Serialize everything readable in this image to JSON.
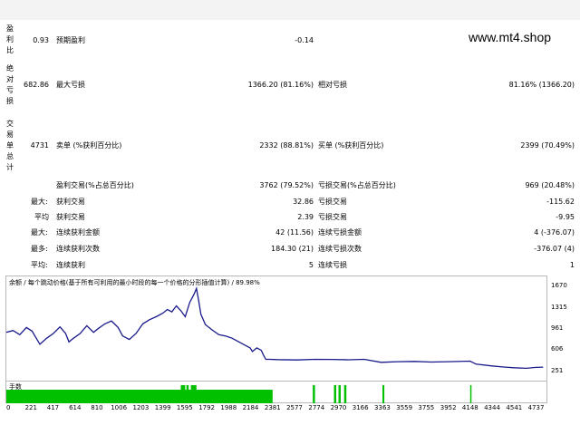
{
  "watermark": "www.mt4.shop",
  "rows": {
    "r1": {
      "side": [
        "盈",
        "利",
        "比"
      ],
      "v1": "0.93",
      "l2": "预期盈利",
      "v2": "-0.14"
    },
    "r2": {
      "side": [
        "绝",
        "对",
        "亏",
        "损"
      ],
      "v1": "682.86",
      "l2": "最大亏损",
      "v2": "1366.20 (81.16%)",
      "l3": "相对亏损",
      "v3": "81.16% (1366.20)"
    },
    "r3": {
      "side": [
        "交",
        "易",
        "单",
        "总",
        "计"
      ],
      "v1": "4731",
      "l2": "卖单 (%获利百分比)",
      "v2": "2332 (88.81%)",
      "l3": "买单 (%获利百分比)",
      "v3": "2399 (70.49%)"
    },
    "r4": {
      "l2": "盈利交易(%占总百分比)",
      "v2": "3762 (79.52%)",
      "l3": "亏损交易(%占总百分比)",
      "v3": "969 (20.48%)"
    },
    "r5": {
      "l1": "最大:",
      "l2": "获利交易",
      "v2": "32.86",
      "l3": "亏损交易",
      "v3": "-115.62"
    },
    "r6": {
      "l1": "平均",
      "l2": "获利交易",
      "v2": "2.39",
      "l3": "亏损交易",
      "v3": "-9.95"
    },
    "r7": {
      "l1": "最大:",
      "l2": "连续获利金额",
      "v2": "42 (11.56)",
      "l3": "连续亏损金额",
      "v3": "4 (-376.07)"
    },
    "r8": {
      "l1": "最多:",
      "l2": "连续获利次数",
      "v2": "184.30 (21)",
      "l3": "连续亏损次数",
      "v3": "-376.07 (4)"
    },
    "r9": {
      "l1": "平均:",
      "l2": "连续获利",
      "v2": "5",
      "l3": "连续亏损",
      "v3": "1"
    }
  },
  "chart_data": {
    "type": "line",
    "title": "余额 / 每个跳动价格(基于所有可利用的最小时段的每一个价格的分形插值计算) / 89.98%",
    "volume_title": "手数",
    "x_ticks": [
      "0",
      "221",
      "417",
      "614",
      "810",
      "1006",
      "1203",
      "1399",
      "1595",
      "1792",
      "1988",
      "2184",
      "2381",
      "2577",
      "2774",
      "2970",
      "3166",
      "3363",
      "3559",
      "3755",
      "3952",
      "4148",
      "4344",
      "4541",
      "4737"
    ],
    "y_ticks": [
      "1670",
      "1315",
      "961",
      "606",
      "251"
    ],
    "ylim": [
      251,
      1670
    ],
    "xlim": [
      0,
      4830
    ],
    "series": [
      {
        "values": [
          [
            0,
            920
          ],
          [
            60,
            950
          ],
          [
            120,
            880
          ],
          [
            180,
            1000
          ],
          [
            230,
            940
          ],
          [
            300,
            720
          ],
          [
            360,
            820
          ],
          [
            420,
            900
          ],
          [
            480,
            1010
          ],
          [
            530,
            900
          ],
          [
            560,
            760
          ],
          [
            600,
            820
          ],
          [
            660,
            900
          ],
          [
            720,
            1030
          ],
          [
            780,
            920
          ],
          [
            820,
            980
          ],
          [
            880,
            1060
          ],
          [
            940,
            1110
          ],
          [
            1000,
            1000
          ],
          [
            1040,
            860
          ],
          [
            1100,
            800
          ],
          [
            1160,
            900
          ],
          [
            1220,
            1060
          ],
          [
            1280,
            1130
          ],
          [
            1340,
            1180
          ],
          [
            1400,
            1240
          ],
          [
            1440,
            1300
          ],
          [
            1480,
            1260
          ],
          [
            1520,
            1360
          ],
          [
            1560,
            1280
          ],
          [
            1600,
            1180
          ],
          [
            1640,
            1420
          ],
          [
            1680,
            1560
          ],
          [
            1700,
            1650
          ],
          [
            1720,
            1450
          ],
          [
            1740,
            1220
          ],
          [
            1780,
            1050
          ],
          [
            1840,
            960
          ],
          [
            1900,
            880
          ],
          [
            1960,
            860
          ],
          [
            2020,
            820
          ],
          [
            2080,
            760
          ],
          [
            2140,
            700
          ],
          [
            2180,
            660
          ],
          [
            2200,
            600
          ],
          [
            2240,
            660
          ],
          [
            2280,
            620
          ],
          [
            2300,
            540
          ],
          [
            2320,
            470
          ],
          [
            2360,
            470
          ],
          [
            2420,
            465
          ],
          [
            2600,
            460
          ],
          [
            2760,
            470
          ],
          [
            2900,
            468
          ],
          [
            3060,
            462
          ],
          [
            3200,
            470
          ],
          [
            3350,
            420
          ],
          [
            3500,
            430
          ],
          [
            3650,
            435
          ],
          [
            3800,
            425
          ],
          [
            3950,
            430
          ],
          [
            4148,
            440
          ],
          [
            4200,
            390
          ],
          [
            4344,
            360
          ],
          [
            4460,
            340
          ],
          [
            4541,
            330
          ],
          [
            4650,
            320
          ],
          [
            4737,
            335
          ],
          [
            4800,
            340
          ]
        ]
      }
    ],
    "volume_spikes": [
      [
        0,
        2381
      ],
      [
        1560,
        1600
      ],
      [
        1610,
        1630
      ],
      [
        1650,
        1700
      ],
      [
        2740,
        2760
      ],
      [
        2930,
        2950
      ],
      [
        2970,
        2990
      ],
      [
        3020,
        3040
      ],
      [
        3363,
        3380
      ],
      [
        4148,
        4160
      ]
    ]
  }
}
